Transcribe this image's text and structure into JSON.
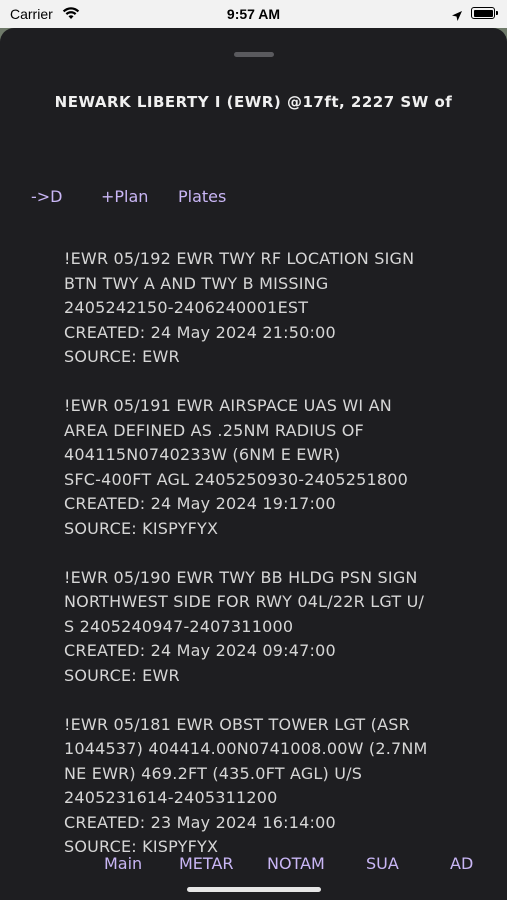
{
  "status_bar": {
    "carrier": "Carrier",
    "time": "9:57 AM"
  },
  "header": {
    "title": "NEWARK LIBERTY I (EWR) @17ft, 2227 SW of"
  },
  "actions": {
    "direct_to": "->D",
    "plan": "+Plan",
    "plates": "Plates"
  },
  "notams": [
    {
      "lines": [
        "!EWR 05/192 EWR TWY RF LOCATION SIGN",
        "BTN TWY A AND TWY B MISSING",
        "2405242150-2406240001EST",
        "CREATED: 24 May 2024 21:50:00",
        "SOURCE: EWR"
      ]
    },
    {
      "lines": [
        "!EWR 05/191 EWR AIRSPACE UAS WI AN",
        "AREA DEFINED AS .25NM RADIUS OF",
        "404115N0740233W (6NM E EWR)",
        "SFC-400FT AGL 2405250930-2405251800",
        "CREATED: 24 May 2024 19:17:00",
        "SOURCE: KISPYFYX"
      ]
    },
    {
      "lines": [
        "!EWR 05/190 EWR TWY BB HLDG PSN SIGN",
        "NORTHWEST SIDE FOR RWY 04L/22R LGT U/",
        "S 2405240947-2407311000",
        "CREATED: 24 May 2024 09:47:00",
        "SOURCE: EWR"
      ]
    },
    {
      "lines": [
        "!EWR 05/181 EWR OBST TOWER LGT (ASR",
        "1044537) 404414.00N0741008.00W (2.7NM",
        "NE EWR) 469.2FT (435.0FT AGL) U/S",
        "2405231614-2405311200",
        "CREATED: 23 May 2024 16:14:00",
        "SOURCE: KISPYFYX"
      ]
    }
  ],
  "tabs": [
    {
      "label": "Main"
    },
    {
      "label": "METAR"
    },
    {
      "label": "NOTAM"
    },
    {
      "label": "SUA"
    },
    {
      "label": "AD"
    }
  ],
  "colors": {
    "background": "#1e1e21",
    "accent": "#c9b6f5",
    "text": "#d6d6d6"
  },
  "icons": [
    "wifi-icon",
    "location-arrow-icon",
    "battery-icon"
  ]
}
